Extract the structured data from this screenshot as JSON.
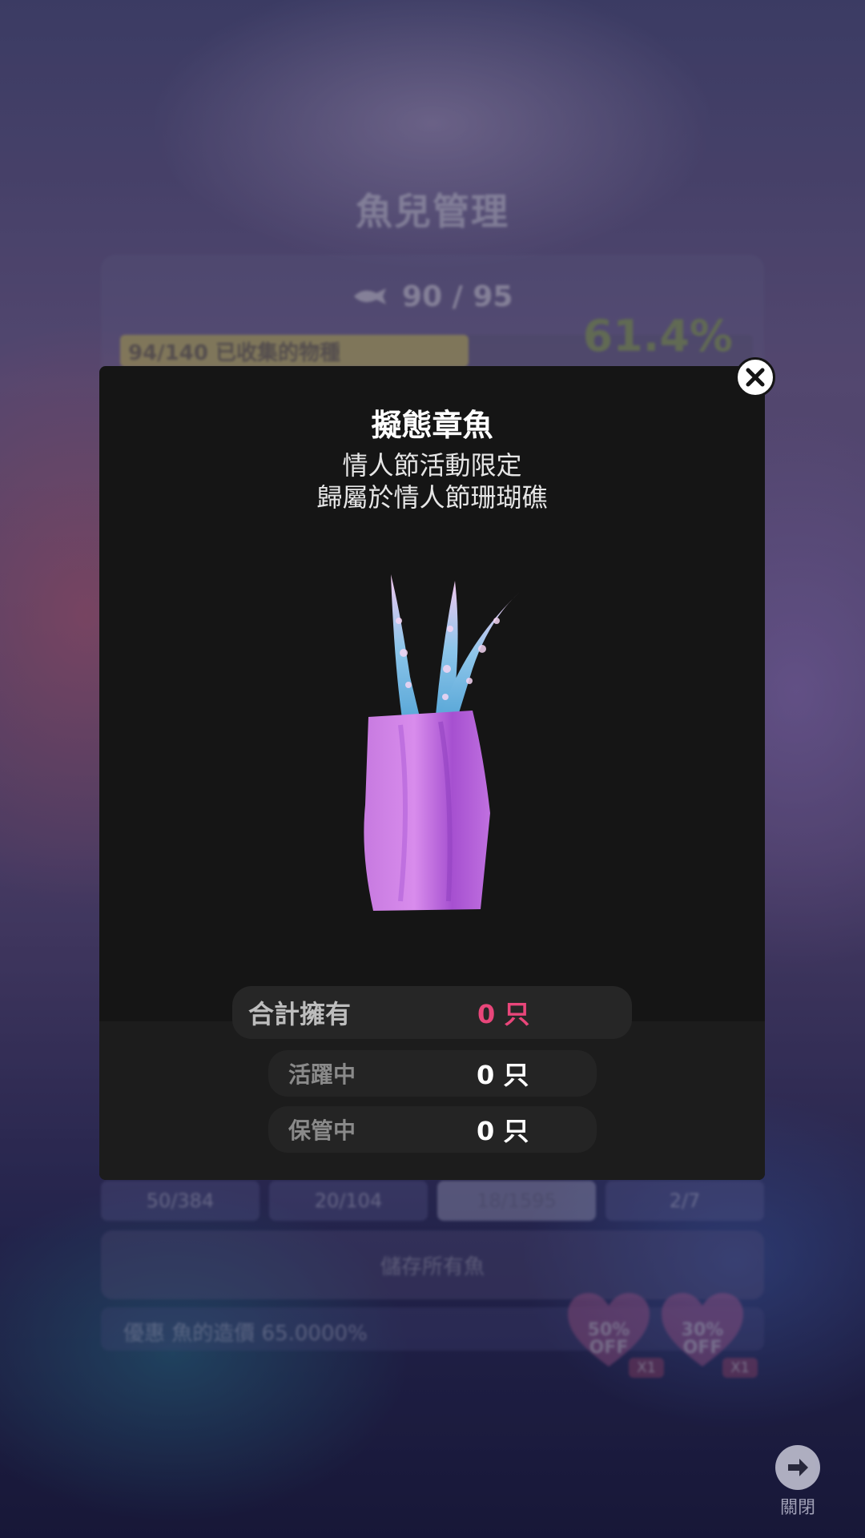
{
  "background": {
    "title": "魚兒管理",
    "fish_count": "90 / 95",
    "progress_text": "94/140 已收集的物種",
    "progress_fraction": 0.55,
    "completion_percent": "61.4%",
    "tabs": [
      "50/384",
      "20/104",
      "18/1595",
      "2/7"
    ],
    "active_tab_index": 2,
    "save_all_label": "儲存所有魚",
    "discount_text": "優惠 魚的造價 65.0000%",
    "coupons": [
      {
        "line1": "50%",
        "line2": "OFF",
        "count": "X1"
      },
      {
        "line1": "30%",
        "line2": "OFF",
        "count": "X1"
      }
    ],
    "exit_label": "關閉"
  },
  "modal": {
    "name": "擬態章魚",
    "event": "情人節活動限定",
    "reef": "歸屬於情人節珊瑚礁",
    "stats": {
      "total_label": "合計擁有",
      "total_value": "0 只",
      "active_label": "活躍中",
      "active_value": "0 只",
      "stored_label": "保管中",
      "stored_value": "0 只"
    }
  },
  "colors": {
    "accent_pink": "#e8467a",
    "progress_yellow": "#d8cf5a",
    "percent_green": "#8fb04a"
  },
  "icons": {
    "close": "close-icon",
    "exit": "arrow-right-circle-icon",
    "fish": "fish-icon"
  }
}
